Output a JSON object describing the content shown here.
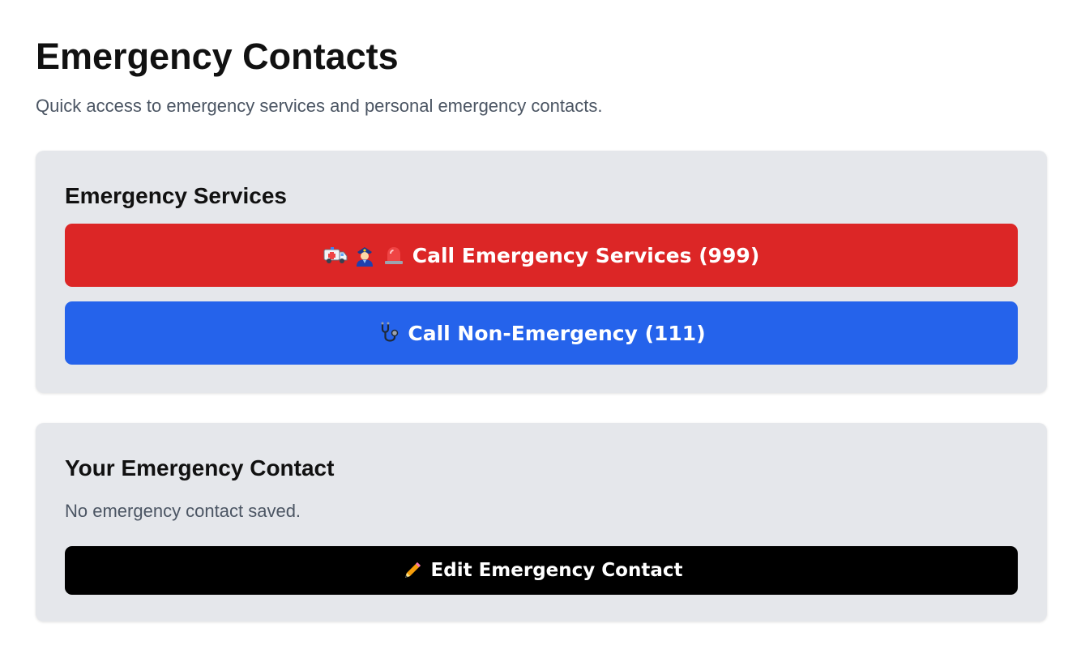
{
  "header": {
    "title": "Emergency Contacts",
    "subtitle": "Quick access to emergency services and personal emergency contacts."
  },
  "services": {
    "title": "Emergency Services",
    "emergency_button": {
      "label": "Call Emergency Services (999)",
      "color": "#dc2626",
      "icons": [
        "ambulance-icon",
        "police-officer-icon",
        "siren-icon"
      ]
    },
    "non_emergency_button": {
      "label": "Call Non-Emergency (111)",
      "color": "#2563eb",
      "icons": [
        "stethoscope-icon"
      ]
    }
  },
  "contact": {
    "title": "Your Emergency Contact",
    "status": "No emergency contact saved.",
    "edit_button": {
      "label": "Edit Emergency Contact",
      "color": "#000000",
      "icons": [
        "pencil-icon"
      ]
    }
  }
}
